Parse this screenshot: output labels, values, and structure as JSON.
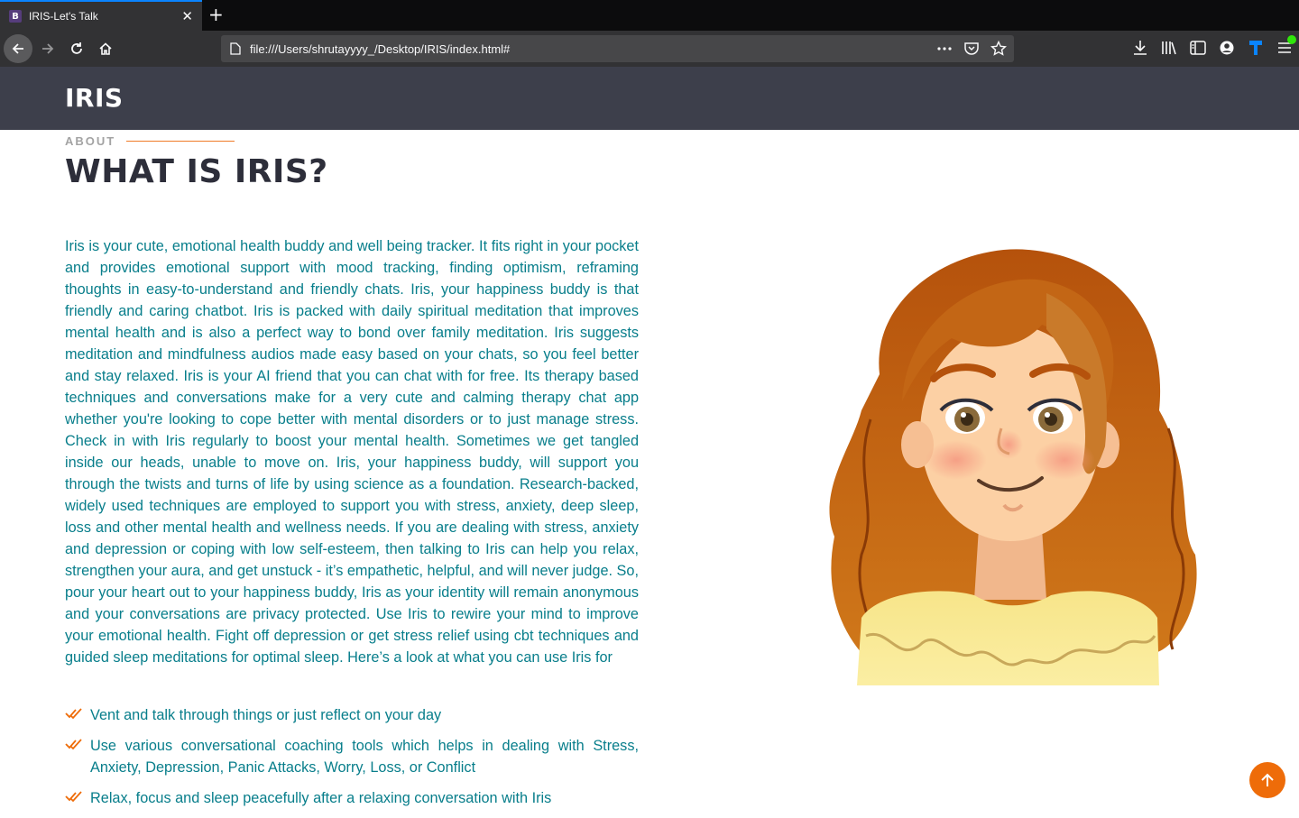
{
  "browser": {
    "tab_title": "IRIS-Let's Talk",
    "tab_favicon_letter": "B",
    "url": "file:///Users/shrutayyyy_/Desktop/IRIS/index.html#"
  },
  "header": {
    "logo": "IRIS"
  },
  "about": {
    "label": "ABOUT",
    "title": "WHAT IS IRIS?",
    "paragraph": "Iris is your cute, emotional health buddy and well being tracker. It fits right in your pocket and provides emotional support with mood tracking, finding optimism, reframing thoughts in easy-to-understand and friendly chats. Iris, your happiness buddy is that friendly and caring chatbot. Iris is packed with daily spiritual meditation that improves mental health and is also a perfect way to bond over family meditation. Iris suggests meditation and mindfulness audios made easy based on your chats, so you feel better and stay relaxed. Iris is your AI friend that you can chat with for free. Its therapy based techniques and conversations make for a very cute and calming therapy chat app whether you're looking to cope better with mental disorders or to just manage stress. Check in with Iris regularly to boost your mental health. Sometimes we get tangled inside our heads, unable to move on. Iris, your happiness buddy, will support you through the twists and turns of life by using science as a foundation. Research-backed, widely used techniques are employed to support you with stress, anxiety, deep sleep, loss and other mental health and wellness needs. If you are dealing with stress, anxiety and depression or coping with low self-esteem, then talking to Iris can help you relax, strengthen your aura, and get unstuck - it’s empathetic, helpful, and will never judge. So, pour your heart out to your happiness buddy, Iris as your identity will remain anonymous and your conversations are privacy protected. Use Iris to rewire your mind to improve your emotional health. Fight off depression or get stress relief using cbt techniques and guided sleep meditations for optimal sleep. Here’s a look at what you can use Iris for",
    "features": [
      "Vent and talk through things or just reflect on your day",
      "Use various conversational coaching tools which helps in dealing with Stress, Anxiety, Depression, Panic Attacks, Worry, Loss, or Conflict",
      "Relax, focus and sleep peacefully after a relaxing conversation with Iris"
    ]
  },
  "icons": {
    "back": "arrow-left-icon",
    "forward": "arrow-right-icon",
    "reload": "reload-icon",
    "home": "home-icon",
    "page": "page-icon",
    "more": "more-icon",
    "pocket": "pocket-icon",
    "bookmark": "star-icon",
    "download": "download-icon",
    "library": "library-icon",
    "sidebar": "sidebar-icon",
    "account": "account-icon",
    "extension": "extension-icon",
    "menu": "hamburger-menu-icon",
    "feature_check": "double-check-icon",
    "back_to_top": "arrow-up-icon"
  },
  "colors": {
    "header_bg": "#3d3f4b",
    "text_teal": "#087e8b",
    "accent_orange": "#ee6c09",
    "title_dark": "#2d2e3a"
  }
}
